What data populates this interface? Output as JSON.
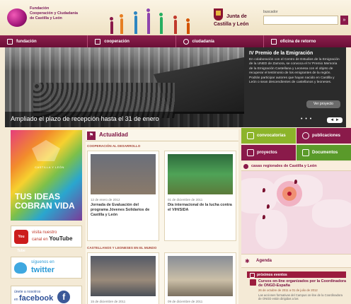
{
  "header": {
    "org_lines": [
      "Fundación",
      "Cooperación y Ciudadanía",
      "de Castilla y León"
    ],
    "jcyl_line1": "Junta de",
    "jcyl_line2": "Castilla y León",
    "search_label": "buscador",
    "search_value": "",
    "search_button": "»"
  },
  "nav": [
    {
      "label": "fundación",
      "icon": "home-icon"
    },
    {
      "label": "cooperación",
      "icon": "people-icon"
    },
    {
      "label": "ciudadanía",
      "icon": "globe-icon"
    },
    {
      "label": "oficina de retorno",
      "icon": "person-icon"
    }
  ],
  "hero": {
    "caption": "Ampliado el plazo de recepción hasta el 31 de enero",
    "panel_title": "IV Premio de la Emigración",
    "panel_text": "En colaboración con el Centro de Estudios de la Emigración de la UNED de Zamora, se convoca el IV Premio Memoria de la Emigración Castellana y Leonesa con el objeto de recuperar el testimonio de los emigrantes de la región. Podrán participar autores que hayan nacido en Castilla y León o sean descendientes de castellanos y leoneses.",
    "more_button": "Ver proyecto",
    "dots": "• • •",
    "arrows": "◄ ►"
  },
  "left": {
    "promo_sub": "CASTILLA Y LEÓN",
    "promo_line1": "TUS IDEAS",
    "promo_line2": "COBRAN VIDA",
    "youtube_badge": "You Tube",
    "youtube_line1": "visita nuestro",
    "youtube_line2": "canal en",
    "youtube_word": "YouTube",
    "twitter_line1": "síguenos en",
    "twitter_word": "twitter",
    "facebook_line1": "únete a nosotros",
    "facebook_line2": "en",
    "facebook_word": "facebook",
    "facebook_icon": "f"
  },
  "actualidad": {
    "title": "Actualidad",
    "icon": "flag-icon",
    "section1": "COOPERACIÓN AL DESARROLLO",
    "section2": "CASTELLANOS Y LEONESES EN EL MUNDO",
    "cards": [
      {
        "date": "12 de enero de 2012",
        "title": "Jornada de Evaluación del programa Jóvenes Solidarios de Castilla y León"
      },
      {
        "date": "01 de diciembre de 2011",
        "title": "Día internacional de la lucha contra el VIH/SIDA"
      },
      {
        "date": "15 de diciembre de 2011",
        "title": ""
      },
      {
        "date": "09 de diciembre de 2011",
        "title": ""
      }
    ]
  },
  "right": {
    "tiles": [
      {
        "label": "convocatorias",
        "color": "#8cb42a"
      },
      {
        "label": "publicaciones",
        "color": "#8a1a4a"
      },
      {
        "label": "proyectos",
        "color": "#8a1a4a"
      },
      {
        "label": "Documentos",
        "color": "#5a9a2a"
      }
    ],
    "map_title": "casas regionales de Castilla y León",
    "agenda_title": "Agenda",
    "events_title": "próximos eventos",
    "event_title": "Cursos on-line organizados por la Coordinadora de ONGD-España",
    "event_date": "26 de octubre de 2011 a 01 de julio de 2012",
    "event_desc": "Las acciones formativas del Campus on-line de la Coordinadora de ONGD están dirigidas a las"
  }
}
